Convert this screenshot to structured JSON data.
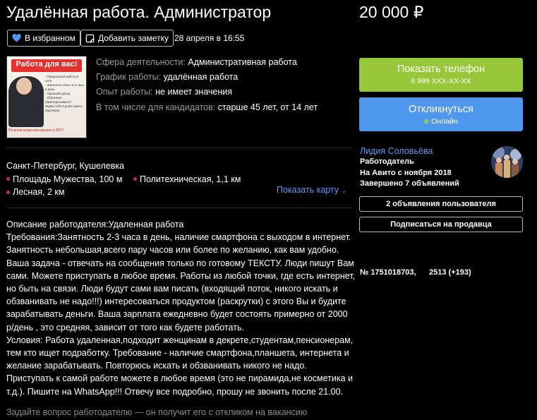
{
  "listing": {
    "title": "Удалённая работа. Администратор",
    "price": "20 000 ₽",
    "favorite_label": "В избранном",
    "note_label": "Добавить заметку",
    "date": "28 апреля в 16:55",
    "thumbnail": {
      "headline": "Работа для вас!",
      "bullets": [
        "- Предлагаем работу в сети",
        "- Занятость всего 2-3 часа в день",
        "- Хороший доход",
        "- Обучение",
        "Заинтересовало?",
        "Ждём тебя в роли своего партнёра!"
      ],
      "footer": "По всем вопросам пишите в ЛС!!!"
    },
    "properties": [
      {
        "key": "Сфера деятельности:",
        "value": "Административная работа"
      },
      {
        "key": "График работы:",
        "value": "удалённая работа"
      },
      {
        "key": "Опыт работы:",
        "value": "не имеет значения"
      },
      {
        "key": "В том числе для кандидатов:",
        "value": "старше 45 лет, от 14 лет"
      }
    ],
    "address": "Санкт-Петербург, Кушелевка",
    "metro": [
      {
        "name": "Площадь Мужества",
        "dist": "100 м"
      },
      {
        "name": "Политехническая",
        "dist": "1,1 км"
      },
      {
        "name": "Лесная",
        "dist": "2 км"
      }
    ],
    "show_map": "Показать карту",
    "description": [
      "Описание работодателя:Удаленная работа",
      "Требования:Занятность 2-3 часа в день, наличие смартфона с выходом в интернет.",
      "Занятность небольшая,всего пару часов или более по желанию, как вам удобно.",
      "Ваша задача - отвечать на сообщения только по готовому ТЕКСТУ. Люди пишут Вам",
      "сами. Можете приступать в любое время. Работы из любой точки, где есть интернет,",
      "но быть на связи. Люди будут сами вам писать (входящий поток, никого искать и",
      "обзванивать не надо!!!) интересоваться продуктом (раскрутки) с этого Вы и будите",
      "зарабатывать деньги. Ваша зарплата ежедневно будет состоять примерно от 2000",
      "р/день , это средняя, зависит от того как будете работать.",
      "Условия: Работа удаленная,подходит женщинам в декрете,студентам,пенсионерам,",
      "тем кто ищет подработку. Требование - наличие смартфона,планшета, интернета и",
      "желание зарабатывать. Повторюсь искать и обзванивать никого не надо.",
      "Приступать к самой работе можете в любое время (это не пирамида,не косметика и",
      "т.д.). Пишите на WhatsApp!!! Отвечу все подробно, прошу не звонить после 21.00."
    ],
    "ask_employer": "Задайте вопрос работодателю — он получит его с откликом на вакансию"
  },
  "sidebar": {
    "show_phone": "Показать телефон",
    "phone": "8 999 XXX-XX-XX",
    "respond": "Откликнуться",
    "online": "Онлайн",
    "seller_name": "Лидия Соловьёва",
    "seller_role": "Работодатель",
    "seller_since": "На Авито с ноября 2018",
    "seller_completed": "Завершено 7 объявлений",
    "user_ads": "2 объявления пользователя",
    "subscribe": "Подписаться на продавца",
    "ad_number": "№ 1751018703,",
    "views": "2513 (+193)"
  },
  "colors": {
    "green": "#97c83a",
    "blue": "#4f97ef",
    "link": "#5c9cf4",
    "metro_dot": "#d6205e",
    "online_dot": "#86d04e"
  }
}
